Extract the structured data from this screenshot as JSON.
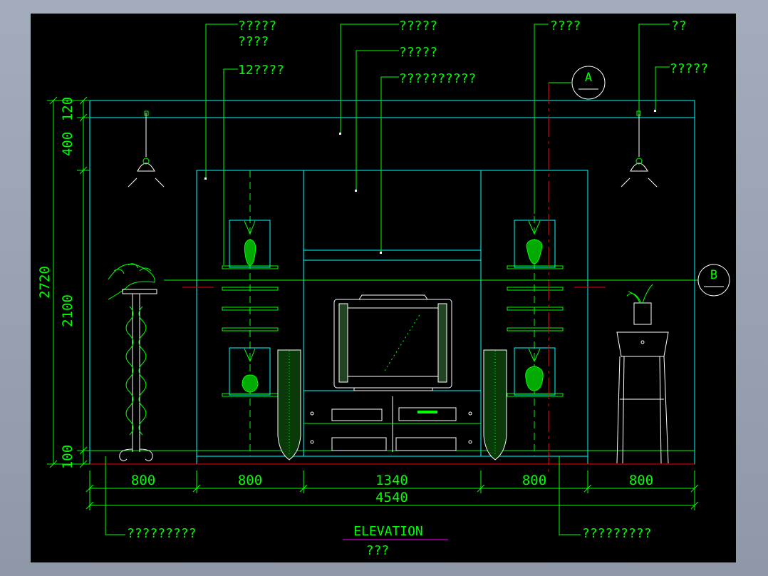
{
  "colors": {
    "background": "#000000",
    "green": "#00ff00",
    "cyan": "#00ffff",
    "red": "#ff0000",
    "magenta": "#ff00ff",
    "white": "#ffffff",
    "frame": "#9ba4b4"
  },
  "leaders": {
    "top_left_a_line1": "?????",
    "top_left_a_line2": "????",
    "top_left_b": "12????",
    "top_center_a": "?????",
    "top_center_b": "?????",
    "top_center_c": "??????????",
    "top_right_a": "????",
    "top_right_b": "??",
    "top_right_c": "?????",
    "bottom_left": "?????????",
    "bottom_right": "?????????"
  },
  "section_markers": {
    "a": "A",
    "b": "B"
  },
  "vertical_dimensions": {
    "total": "2720",
    "top": "120",
    "upper": "400",
    "middle": "2100",
    "bottom": "100"
  },
  "horizontal_dimensions": {
    "seg1": "800",
    "seg2": "800",
    "seg3": "1340",
    "seg4": "800",
    "seg5": "800",
    "total": "4540"
  },
  "title": {
    "label": "ELEVATION",
    "subtitle": "???"
  }
}
